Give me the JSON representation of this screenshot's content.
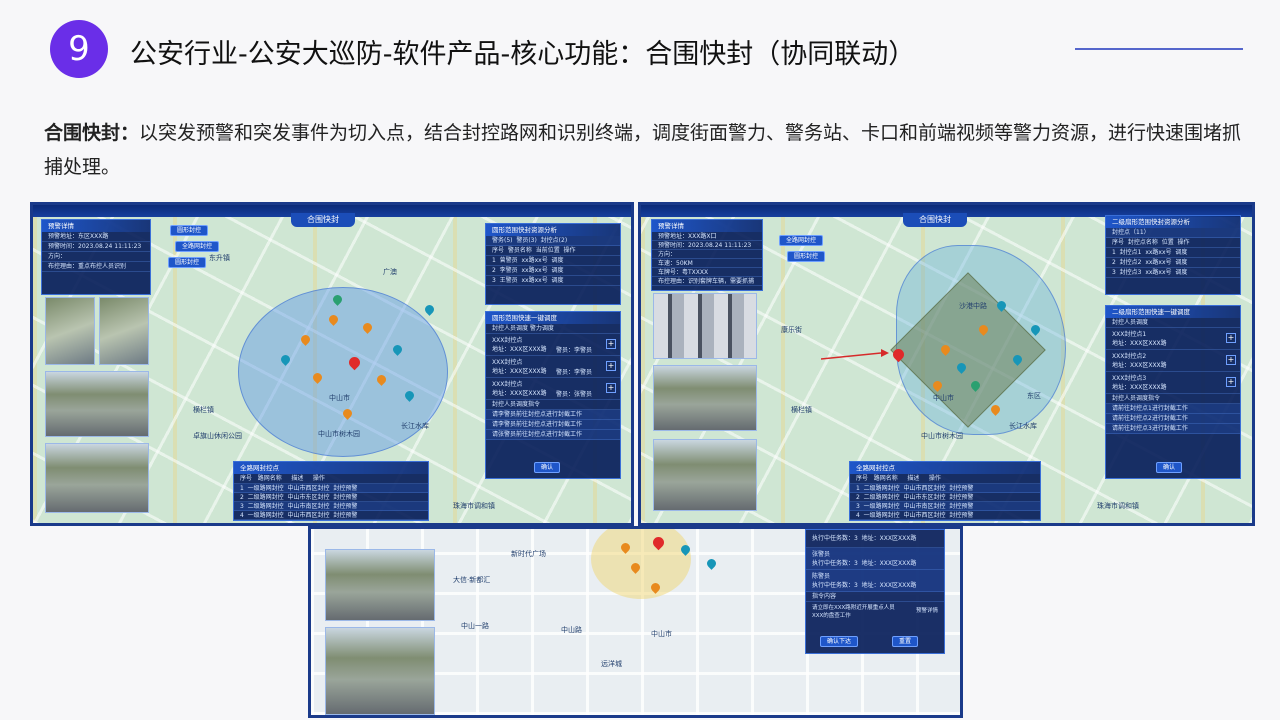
{
  "header": {
    "number": "9",
    "title": "公安行业-公安大巡防-软件产品-核心功能：合围快封（协同联动）"
  },
  "description": {
    "label": "合围快封：",
    "text": "以突发预警和突发事件为切入点，结合封控路网和识别终端，调度街面警力、警务站、卡口和前端视频等警力资源，进行快速围堵抓捕处理。"
  },
  "screen1": {
    "top_title": "合围快封",
    "alarm_panel": {
      "title": "预警详情",
      "lines": [
        "预警地址：东区XXX路",
        "预警时间：2023.08.24 11:11:23",
        "方向：",
        "布控理由：重点布控人员识别"
      ]
    },
    "buttons": [
      "圆形封控",
      "全路网封控",
      "圆形封控"
    ],
    "resource_panel": {
      "title": "圆形范围快封资源分析",
      "tabs": [
        "警务(5)",
        "警员(3)",
        "封控点(2)"
      ],
      "header": [
        "序号",
        "警员名称",
        "当前位置",
        "操作"
      ],
      "rows": [
        [
          "1",
          "曾警员",
          "xx路xx号",
          "调度"
        ],
        [
          "2",
          "李警员",
          "xx路xx号",
          "调度"
        ],
        [
          "3",
          "王警员",
          "xx路xx号",
          "调度"
        ]
      ]
    },
    "dispatch_panel": {
      "title": "圆形范围快速一键调度",
      "tab": "封控人员调度  警力调度",
      "items": [
        [
          "XXX封控点",
          "地址：XXX区XXX路",
          "警员：李警员"
        ],
        [
          "XXX封控点",
          "地址：XXX区XXX路",
          "警员：李警员"
        ],
        [
          "XXX封控点",
          "地址：XXX区XXX路",
          "警员：张警员"
        ]
      ],
      "cmd_title": "封控人员调度指令",
      "cmds": [
        "请李警员前往封控点进行封截工作",
        "请李警员前往封控点进行封截工作",
        "请张警员前往封控点进行封截工作"
      ],
      "confirm": "确认"
    },
    "route_panel": {
      "title": "全路网封控点",
      "header": [
        "序号",
        "路网名称",
        "描述",
        "操作"
      ],
      "rows": [
        [
          "1",
          "一级路网封控",
          "中山市西区封控",
          "封控预警"
        ],
        [
          "2",
          "二级路网封控",
          "中山市东区封控",
          "封控预警"
        ],
        [
          "3",
          "二级路网封控",
          "中山市南区封控",
          "封控预警"
        ],
        [
          "4",
          "一级路网封控",
          "中山市西区封控",
          "封控预警"
        ]
      ]
    },
    "map_labels": [
      "中山市",
      "广澳",
      "中山市树木园",
      "长江水库",
      "横栏镇",
      "卓旗山休闲公园",
      "珠海市调和镇",
      "东升镇"
    ]
  },
  "screen2": {
    "top_title": "合围快封",
    "alarm_panel": {
      "title": "预警详情",
      "lines": [
        "预警地址：XXX路X口",
        "预警时间：2023.08.24 11:11:23",
        "方向：",
        "车速：50KM",
        "车牌号：粤TXXXX",
        "布控理由：识别套牌车辆，需要抓捕"
      ]
    },
    "buttons": [
      "全路网封控",
      "圆形封控"
    ],
    "resource_panel": {
      "title": "二级扇形范围快封资源分析",
      "tab": "封控点（11）",
      "header": [
        "序号",
        "封控点名称",
        "位置",
        "操作"
      ],
      "rows": [
        [
          "1",
          "封控点1",
          "xx路xx号",
          "调度"
        ],
        [
          "2",
          "封控点2",
          "xx路xx号",
          "调度"
        ],
        [
          "3",
          "封控点3",
          "xx路xx号",
          "调度"
        ]
      ]
    },
    "dispatch_panel": {
      "title": "二级扇形范围快速一键调度",
      "tab": "封控人员调度",
      "items": [
        [
          "XXX封控点1",
          "地址：XXX区XXX路"
        ],
        [
          "XXX封控点2",
          "地址：XXX区XXX路"
        ],
        [
          "XXX封控点3",
          "地址：XXX区XXX路"
        ]
      ],
      "cmd_title": "封控人员调度指令",
      "cmds": [
        "请前往封控点1进行封截工作",
        "请前往封控点2进行封截工作",
        "请前往封控点3进行封截工作"
      ],
      "confirm": "确认"
    },
    "route_panel": {
      "title": "全路网封控点",
      "header": [
        "序号",
        "路网名称",
        "描述",
        "操作"
      ],
      "rows": [
        [
          "1",
          "二级路网封控",
          "中山市西区封控",
          "封控预警"
        ],
        [
          "2",
          "二级路网封控",
          "中山市东区封控",
          "封控预警"
        ],
        [
          "3",
          "一级路网封控",
          "中山市南区封控",
          "封控预警"
        ],
        [
          "4",
          "一级路网封控",
          "中山市西区封控",
          "封控预警"
        ]
      ]
    },
    "map_labels": [
      "中山市",
      "沙港中路",
      "中山市树木园",
      "长江水库",
      "横栏镇",
      "珠海市调和镇",
      "东区",
      "康乐街"
    ]
  },
  "screen3": {
    "staff": [
      [
        "执行中任务数：3",
        "地址：XXX区XXX路"
      ],
      [
        "张警员",
        "执行中任务数：3",
        "地址：XXX区XXX路"
      ],
      [
        "陈警员",
        "执行中任务数：3",
        "地址：XXX区XXX路"
      ]
    ],
    "cmd_title": "指令内容",
    "cmd_text": "请立即在XXX路附近开展重点人员XXX的盘查工作",
    "cmd_action": "预警详情",
    "buttons": [
      "确认下达",
      "重置"
    ],
    "map_labels": [
      "新时代广场",
      "中山市",
      "中山路",
      "中山一路",
      "大信·新都汇",
      "远洋城"
    ]
  }
}
